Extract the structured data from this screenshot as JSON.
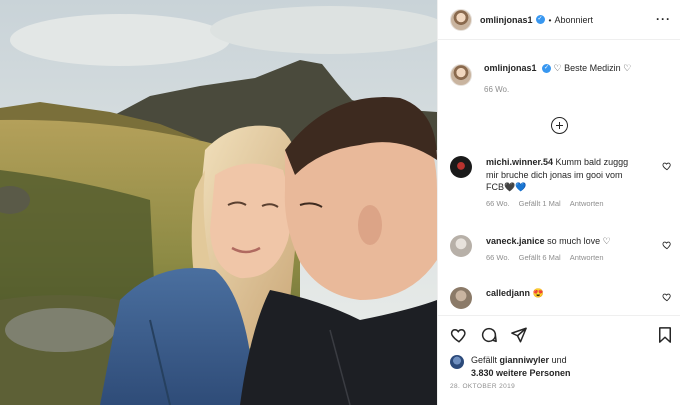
{
  "post": {
    "author": "omlinjonas1",
    "follow_status": "Abonniert",
    "dot": "•",
    "more_icon": "···"
  },
  "caption": {
    "username": "omlinjonas1",
    "text": "♡ Beste Medizin ♡",
    "time": "66 Wo."
  },
  "comments": [
    {
      "username": "michi.winner.54",
      "text": "Kumm bald zuggg mir bruche dich jonas im gooi vom FCB🖤💙",
      "time": "66 Wo.",
      "likes": "Gefällt 1 Mal",
      "reply": "Antworten"
    },
    {
      "username": "vaneck.janice",
      "text": "so much love ♡",
      "time": "66 Wo.",
      "likes": "Gefällt 6 Mal",
      "reply": "Antworten"
    },
    {
      "username": "calledjann",
      "text": "😍"
    }
  ],
  "likes": {
    "prefix": "Gefällt",
    "user": "gianniwyler",
    "connector": "und",
    "others": "3.830 weitere Personen"
  },
  "date": "28. OKTOBER 2019",
  "icons": {
    "like": "heart-icon",
    "comment": "comment-icon",
    "share": "share-icon",
    "save": "bookmark-icon",
    "verified": "verified-badge-icon",
    "load_more": "plus-circle-icon"
  },
  "colors": {
    "verified_blue": "#3897f0",
    "text": "#262626",
    "muted": "#8e8e8e",
    "border": "#efefef"
  }
}
